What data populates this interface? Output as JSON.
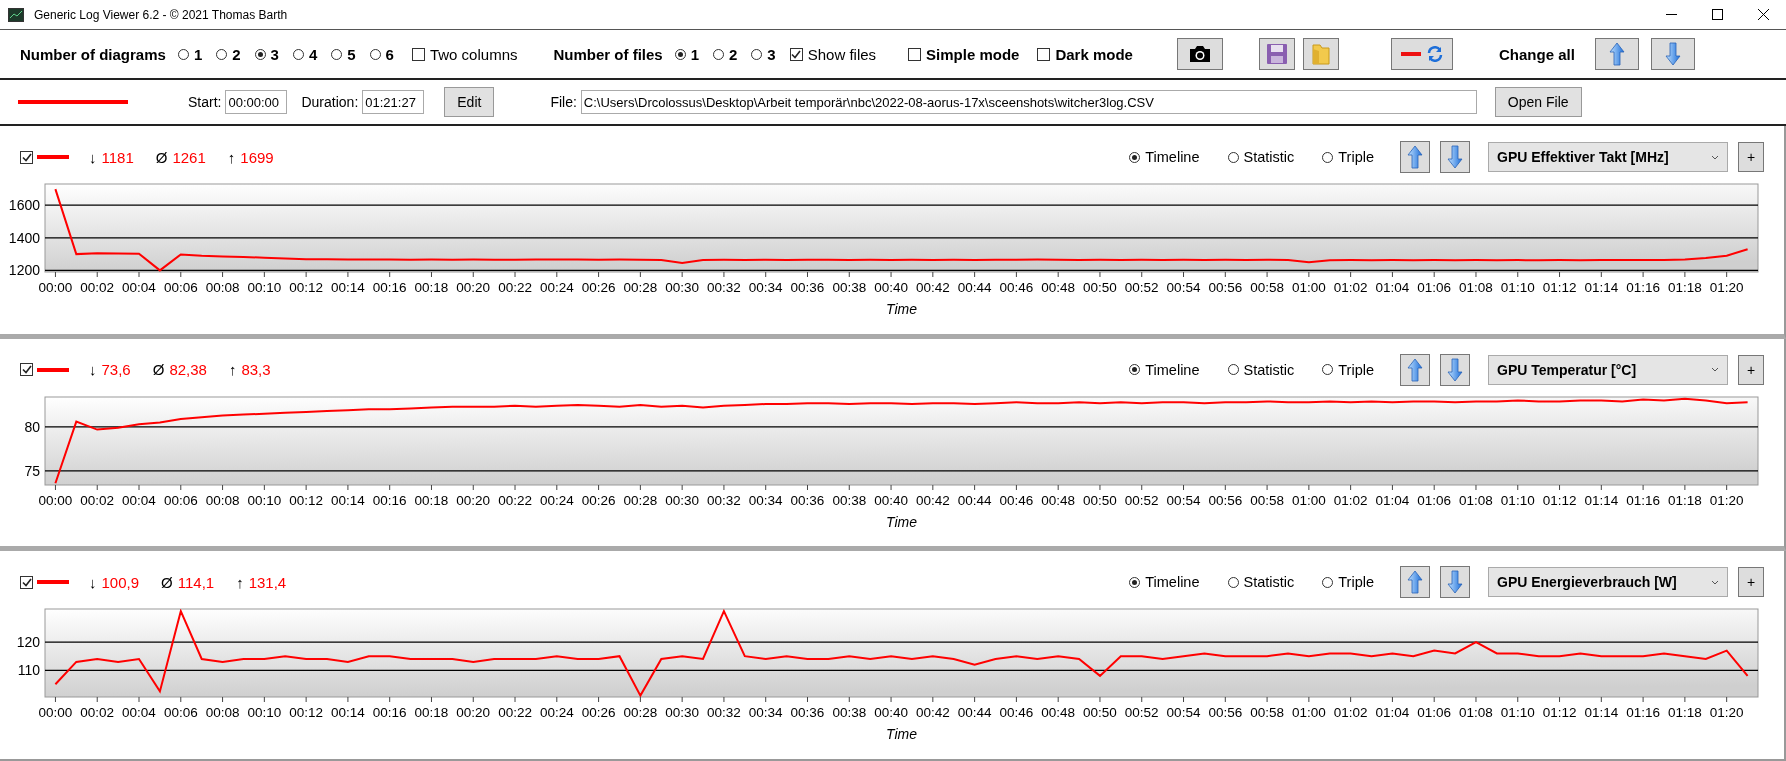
{
  "window": {
    "title": "Generic Log Viewer 6.2 - © 2021 Thomas Barth"
  },
  "toolbar": {
    "diagrams": {
      "label": "Number of diagrams",
      "options": [
        {
          "label": "1",
          "selected": false
        },
        {
          "label": "2",
          "selected": false
        },
        {
          "label": "3",
          "selected": true
        },
        {
          "label": "4",
          "selected": false
        },
        {
          "label": "5",
          "selected": false
        },
        {
          "label": "6",
          "selected": false
        }
      ]
    },
    "two_columns": {
      "label": "Two columns",
      "checked": false
    },
    "files": {
      "label": "Number of files",
      "options": [
        {
          "label": "1",
          "selected": true
        },
        {
          "label": "2",
          "selected": false
        },
        {
          "label": "3",
          "selected": false
        }
      ]
    },
    "show_files": {
      "label": "Show files",
      "checked": true
    },
    "simple_mode": {
      "label": "Simple mode",
      "checked": false
    },
    "dark_mode": {
      "label": "Dark mode",
      "checked": false
    },
    "change_all_label": "Change all"
  },
  "file_row": {
    "color": "#ff0000",
    "start_label": "Start:",
    "start": "00:00:00",
    "duration_label": "Duration:",
    "duration": "01:21:27",
    "edit_button": "Edit",
    "file_label": "File:",
    "path": "C:\\Users\\Drcolossus\\Desktop\\Arbeit temporär\\nbc\\2022-08-aorus-17x\\sceenshots\\witcher3log.CSV",
    "open_button": "Open File"
  },
  "panels": [
    {
      "checked": true,
      "color": "#ff0000",
      "stats": [
        {
          "symbol": "↓",
          "value": "1181"
        },
        {
          "symbol": "Ø",
          "value": "1261"
        },
        {
          "symbol": "↑",
          "value": "1699"
        }
      ],
      "view_modes": [
        {
          "label": "Timeline",
          "selected": true
        },
        {
          "label": "Statistic",
          "selected": false
        },
        {
          "label": "Triple",
          "selected": false
        }
      ],
      "channel": "GPU Effektiver Takt [MHz]",
      "add_button": "+",
      "chart_data": {
        "type": "line",
        "xlabel": "Time",
        "xlim": [
          -0.5,
          81.5
        ],
        "ylim": [
          1190,
          1730
        ],
        "yticks": [
          1200,
          1400,
          1600
        ],
        "xticks": [
          {
            "value": 0,
            "label": "00:00"
          },
          {
            "value": 2,
            "label": "00:02"
          },
          {
            "value": 4,
            "label": "00:04"
          },
          {
            "value": 6,
            "label": "00:06"
          },
          {
            "value": 8,
            "label": "00:08"
          },
          {
            "value": 10,
            "label": "00:10"
          },
          {
            "value": 12,
            "label": "00:12"
          },
          {
            "value": 14,
            "label": "00:14"
          },
          {
            "value": 16,
            "label": "00:16"
          },
          {
            "value": 18,
            "label": "00:18"
          },
          {
            "value": 20,
            "label": "00:20"
          },
          {
            "value": 22,
            "label": "00:22"
          },
          {
            "value": 24,
            "label": "00:24"
          },
          {
            "value": 26,
            "label": "00:26"
          },
          {
            "value": 28,
            "label": "00:28"
          },
          {
            "value": 30,
            "label": "00:30"
          },
          {
            "value": 32,
            "label": "00:32"
          },
          {
            "value": 34,
            "label": "00:34"
          },
          {
            "value": 36,
            "label": "00:36"
          },
          {
            "value": 38,
            "label": "00:38"
          },
          {
            "value": 40,
            "label": "00:40"
          },
          {
            "value": 42,
            "label": "00:42"
          },
          {
            "value": 44,
            "label": "00:44"
          },
          {
            "value": 46,
            "label": "00:46"
          },
          {
            "value": 48,
            "label": "00:48"
          },
          {
            "value": 50,
            "label": "00:50"
          },
          {
            "value": 52,
            "label": "00:52"
          },
          {
            "value": 54,
            "label": "00:54"
          },
          {
            "value": 56,
            "label": "00:56"
          },
          {
            "value": 58,
            "label": "00:58"
          },
          {
            "value": 60,
            "label": "01:00"
          },
          {
            "value": 62,
            "label": "01:02"
          },
          {
            "value": 64,
            "label": "01:04"
          },
          {
            "value": 66,
            "label": "01:06"
          },
          {
            "value": 68,
            "label": "01:08"
          },
          {
            "value": 70,
            "label": "01:10"
          },
          {
            "value": 72,
            "label": "01:12"
          },
          {
            "value": 74,
            "label": "01:14"
          },
          {
            "value": 76,
            "label": "01:16"
          },
          {
            "value": 78,
            "label": "01:18"
          },
          {
            "value": 80,
            "label": "01:20"
          }
        ],
        "x": [
          0,
          1,
          2,
          3,
          4,
          5,
          6,
          7,
          8,
          9,
          10,
          11,
          12,
          13,
          14,
          15,
          16,
          17,
          18,
          19,
          20,
          21,
          22,
          23,
          24,
          25,
          26,
          27,
          28,
          29,
          30,
          31,
          32,
          33,
          34,
          35,
          36,
          37,
          38,
          39,
          40,
          41,
          42,
          43,
          44,
          45,
          46,
          47,
          48,
          49,
          50,
          51,
          52,
          53,
          54,
          55,
          56,
          57,
          58,
          59,
          60,
          61,
          62,
          63,
          64,
          65,
          66,
          67,
          68,
          69,
          70,
          71,
          72,
          73,
          74,
          75,
          76,
          77,
          78,
          79,
          80,
          81
        ],
        "series": [
          {
            "color": "#ff0000",
            "values": [
              1699,
              1300,
              1305,
              1303,
              1302,
              1200,
              1298,
              1290,
              1285,
              1282,
              1278,
              1272,
              1268,
              1268,
              1267,
              1266,
              1266,
              1265,
              1266,
              1265,
              1266,
              1265,
              1265,
              1266,
              1267,
              1266,
              1265,
              1266,
              1265,
              1264,
              1245,
              1264,
              1265,
              1264,
              1265,
              1264,
              1265,
              1265,
              1264,
              1265,
              1264,
              1265,
              1264,
              1265,
              1264,
              1265,
              1265,
              1266,
              1265,
              1264,
              1265,
              1264,
              1265,
              1264,
              1265,
              1264,
              1265,
              1264,
              1265,
              1264,
              1250,
              1262,
              1263,
              1262,
              1263,
              1262,
              1263,
              1262,
              1263,
              1262,
              1263,
              1262,
              1263,
              1262,
              1263,
              1264,
              1263,
              1264,
              1266,
              1275,
              1290,
              1330
            ]
          }
        ]
      }
    },
    {
      "checked": true,
      "color": "#ff0000",
      "stats": [
        {
          "symbol": "↓",
          "value": "73,6"
        },
        {
          "symbol": "Ø",
          "value": "82,38"
        },
        {
          "symbol": "↑",
          "value": "83,3"
        }
      ],
      "view_modes": [
        {
          "label": "Timeline",
          "selected": true
        },
        {
          "label": "Statistic",
          "selected": false
        },
        {
          "label": "Triple",
          "selected": false
        }
      ],
      "channel": "GPU Temperatur [°C]",
      "add_button": "+",
      "chart_data": {
        "type": "line",
        "xlabel": "Time",
        "xlim": [
          -0.5,
          81.5
        ],
        "ylim": [
          73.4,
          83.4
        ],
        "yticks": [
          75,
          80
        ],
        "xticks": [
          {
            "value": 0,
            "label": "00:00"
          },
          {
            "value": 2,
            "label": "00:02"
          },
          {
            "value": 4,
            "label": "00:04"
          },
          {
            "value": 6,
            "label": "00:06"
          },
          {
            "value": 8,
            "label": "00:08"
          },
          {
            "value": 10,
            "label": "00:10"
          },
          {
            "value": 12,
            "label": "00:12"
          },
          {
            "value": 14,
            "label": "00:14"
          },
          {
            "value": 16,
            "label": "00:16"
          },
          {
            "value": 18,
            "label": "00:18"
          },
          {
            "value": 20,
            "label": "00:20"
          },
          {
            "value": 22,
            "label": "00:22"
          },
          {
            "value": 24,
            "label": "00:24"
          },
          {
            "value": 26,
            "label": "00:26"
          },
          {
            "value": 28,
            "label": "00:28"
          },
          {
            "value": 30,
            "label": "00:30"
          },
          {
            "value": 32,
            "label": "00:32"
          },
          {
            "value": 34,
            "label": "00:34"
          },
          {
            "value": 36,
            "label": "00:36"
          },
          {
            "value": 38,
            "label": "00:38"
          },
          {
            "value": 40,
            "label": "00:40"
          },
          {
            "value": 42,
            "label": "00:42"
          },
          {
            "value": 44,
            "label": "00:44"
          },
          {
            "value": 46,
            "label": "00:46"
          },
          {
            "value": 48,
            "label": "00:48"
          },
          {
            "value": 50,
            "label": "00:50"
          },
          {
            "value": 52,
            "label": "00:52"
          },
          {
            "value": 54,
            "label": "00:54"
          },
          {
            "value": 56,
            "label": "00:56"
          },
          {
            "value": 58,
            "label": "00:58"
          },
          {
            "value": 60,
            "label": "01:00"
          },
          {
            "value": 62,
            "label": "01:02"
          },
          {
            "value": 64,
            "label": "01:04"
          },
          {
            "value": 66,
            "label": "01:06"
          },
          {
            "value": 68,
            "label": "01:08"
          },
          {
            "value": 70,
            "label": "01:10"
          },
          {
            "value": 72,
            "label": "01:12"
          },
          {
            "value": 74,
            "label": "01:14"
          },
          {
            "value": 76,
            "label": "01:16"
          },
          {
            "value": 78,
            "label": "01:18"
          },
          {
            "value": 80,
            "label": "01:20"
          }
        ],
        "x": [
          0,
          1,
          2,
          3,
          4,
          5,
          6,
          7,
          8,
          9,
          10,
          11,
          12,
          13,
          14,
          15,
          16,
          17,
          18,
          19,
          20,
          21,
          22,
          23,
          24,
          25,
          26,
          27,
          28,
          29,
          30,
          31,
          32,
          33,
          34,
          35,
          36,
          37,
          38,
          39,
          40,
          41,
          42,
          43,
          44,
          45,
          46,
          47,
          48,
          49,
          50,
          51,
          52,
          53,
          54,
          55,
          56,
          57,
          58,
          59,
          60,
          61,
          62,
          63,
          64,
          65,
          66,
          67,
          68,
          69,
          70,
          71,
          72,
          73,
          74,
          75,
          76,
          77,
          78,
          79,
          80,
          81
        ],
        "series": [
          {
            "color": "#ff0000",
            "values": [
              73.6,
              80.6,
              79.7,
              79.9,
              80.3,
              80.5,
              80.9,
              81.1,
              81.3,
              81.4,
              81.5,
              81.6,
              81.7,
              81.8,
              81.9,
              82.0,
              82.0,
              82.1,
              82.2,
              82.3,
              82.3,
              82.3,
              82.4,
              82.3,
              82.4,
              82.5,
              82.4,
              82.3,
              82.5,
              82.3,
              82.4,
              82.2,
              82.4,
              82.5,
              82.6,
              82.6,
              82.7,
              82.7,
              82.6,
              82.7,
              82.7,
              82.6,
              82.7,
              82.7,
              82.6,
              82.7,
              82.8,
              82.7,
              82.7,
              82.8,
              82.7,
              82.8,
              82.7,
              82.8,
              82.8,
              82.7,
              82.8,
              82.8,
              82.9,
              82.8,
              82.8,
              82.9,
              82.8,
              82.9,
              82.8,
              82.9,
              82.9,
              82.8,
              82.9,
              82.9,
              83.0,
              82.9,
              82.9,
              83.0,
              83.0,
              82.9,
              83.1,
              83.0,
              83.2,
              83.0,
              82.7,
              82.8
            ]
          }
        ]
      }
    },
    {
      "checked": true,
      "color": "#ff0000",
      "stats": [
        {
          "symbol": "↓",
          "value": "100,9"
        },
        {
          "symbol": "Ø",
          "value": "114,1"
        },
        {
          "symbol": "↑",
          "value": "131,4"
        }
      ],
      "view_modes": [
        {
          "label": "Timeline",
          "selected": true
        },
        {
          "label": "Statistic",
          "selected": false
        },
        {
          "label": "Triple",
          "selected": false
        }
      ],
      "channel": "GPU Energieverbrauch [W]",
      "add_button": "+",
      "chart_data": {
        "type": "line",
        "xlabel": "Time",
        "xlim": [
          -0.5,
          81.5
        ],
        "ylim": [
          100.5,
          131.8
        ],
        "yticks": [
          110,
          120
        ],
        "xticks": [
          {
            "value": 0,
            "label": "00:00"
          },
          {
            "value": 2,
            "label": "00:02"
          },
          {
            "value": 4,
            "label": "00:04"
          },
          {
            "value": 6,
            "label": "00:06"
          },
          {
            "value": 8,
            "label": "00:08"
          },
          {
            "value": 10,
            "label": "00:10"
          },
          {
            "value": 12,
            "label": "00:12"
          },
          {
            "value": 14,
            "label": "00:14"
          },
          {
            "value": 16,
            "label": "00:16"
          },
          {
            "value": 18,
            "label": "00:18"
          },
          {
            "value": 20,
            "label": "00:20"
          },
          {
            "value": 22,
            "label": "00:22"
          },
          {
            "value": 24,
            "label": "00:24"
          },
          {
            "value": 26,
            "label": "00:26"
          },
          {
            "value": 28,
            "label": "00:28"
          },
          {
            "value": 30,
            "label": "00:30"
          },
          {
            "value": 32,
            "label": "00:32"
          },
          {
            "value": 34,
            "label": "00:34"
          },
          {
            "value": 36,
            "label": "00:36"
          },
          {
            "value": 38,
            "label": "00:38"
          },
          {
            "value": 40,
            "label": "00:40"
          },
          {
            "value": 42,
            "label": "00:42"
          },
          {
            "value": 44,
            "label": "00:44"
          },
          {
            "value": 46,
            "label": "00:46"
          },
          {
            "value": 48,
            "label": "00:48"
          },
          {
            "value": 50,
            "label": "00:50"
          },
          {
            "value": 52,
            "label": "00:52"
          },
          {
            "value": 54,
            "label": "00:54"
          },
          {
            "value": 56,
            "label": "00:56"
          },
          {
            "value": 58,
            "label": "00:58"
          },
          {
            "value": 60,
            "label": "01:00"
          },
          {
            "value": 62,
            "label": "01:02"
          },
          {
            "value": 64,
            "label": "01:04"
          },
          {
            "value": 66,
            "label": "01:06"
          },
          {
            "value": 68,
            "label": "01:08"
          },
          {
            "value": 70,
            "label": "01:10"
          },
          {
            "value": 72,
            "label": "01:12"
          },
          {
            "value": 74,
            "label": "01:14"
          },
          {
            "value": 76,
            "label": "01:16"
          },
          {
            "value": 78,
            "label": "01:18"
          },
          {
            "value": 80,
            "label": "01:20"
          }
        ],
        "x": [
          0,
          1,
          2,
          3,
          4,
          5,
          6,
          7,
          8,
          9,
          10,
          11,
          12,
          13,
          14,
          15,
          16,
          17,
          18,
          19,
          20,
          21,
          22,
          23,
          24,
          25,
          26,
          27,
          28,
          29,
          30,
          31,
          32,
          33,
          34,
          35,
          36,
          37,
          38,
          39,
          40,
          41,
          42,
          43,
          44,
          45,
          46,
          47,
          48,
          49,
          50,
          51,
          52,
          53,
          54,
          55,
          56,
          57,
          58,
          59,
          60,
          61,
          62,
          63,
          64,
          65,
          66,
          67,
          68,
          69,
          70,
          71,
          72,
          73,
          74,
          75,
          76,
          77,
          78,
          79,
          80,
          81
        ],
        "series": [
          {
            "color": "#ff0000",
            "values": [
              105,
              113,
              114,
              113,
              114,
              102.5,
              131,
              114,
              113,
              114,
              114,
              115,
              114,
              114,
              113,
              115,
              115,
              114,
              114,
              114,
              113,
              114,
              114,
              114,
              115,
              114,
              114,
              115,
              101,
              114,
              115,
              114,
              131,
              115,
              114,
              115,
              114,
              114,
              115,
              114,
              115,
              114,
              115,
              114,
              112,
              114,
              115,
              114,
              115,
              114,
              108,
              115,
              115,
              114,
              115,
              116,
              115,
              115,
              115,
              116,
              115,
              116,
              116,
              115,
              116,
              115,
              117,
              116,
              120,
              116,
              116,
              115,
              115,
              116,
              115,
              115,
              115,
              116,
              115,
              114,
              117,
              108
            ]
          }
        ]
      }
    }
  ]
}
